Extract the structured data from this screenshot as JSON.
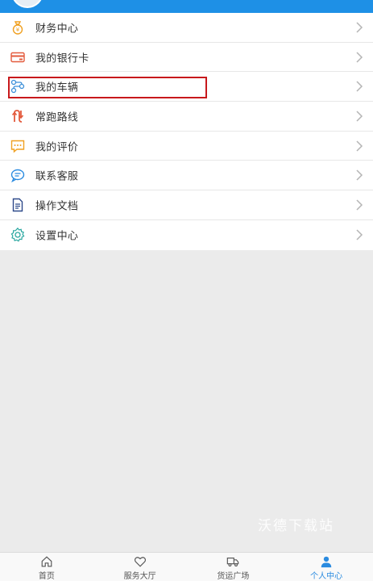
{
  "menu": {
    "items": [
      {
        "label": "财务中心",
        "icon": "money-bag-icon",
        "color": "#f0a020"
      },
      {
        "label": "我的银行卡",
        "icon": "bank-card-icon",
        "color": "#e35a3c"
      },
      {
        "label": "我的车辆",
        "icon": "vehicle-route-icon",
        "color": "#3b8fd9"
      },
      {
        "label": "常跑路线",
        "icon": "route-arrows-icon",
        "color": "#e35a3c"
      },
      {
        "label": "我的评价",
        "icon": "comment-icon",
        "color": "#f0a020"
      },
      {
        "label": "联系客服",
        "icon": "chat-bubble-icon",
        "color": "#2a8be0"
      },
      {
        "label": "操作文档",
        "icon": "document-icon",
        "color": "#2f4a8a"
      },
      {
        "label": "设置中心",
        "icon": "gear-icon",
        "color": "#2aa7a0"
      }
    ]
  },
  "watermark": "沃德下载站",
  "tabbar": {
    "tabs": [
      {
        "label": "首页",
        "icon": "home-icon"
      },
      {
        "label": "服务大厅",
        "icon": "heart-icon"
      },
      {
        "label": "货运广场",
        "icon": "truck-icon"
      },
      {
        "label": "个人中心",
        "icon": "person-icon"
      }
    ],
    "active_index": 3
  },
  "colors": {
    "header": "#1e90e6",
    "highlight_border": "#c8191c",
    "active_tab": "#2a8be0"
  }
}
